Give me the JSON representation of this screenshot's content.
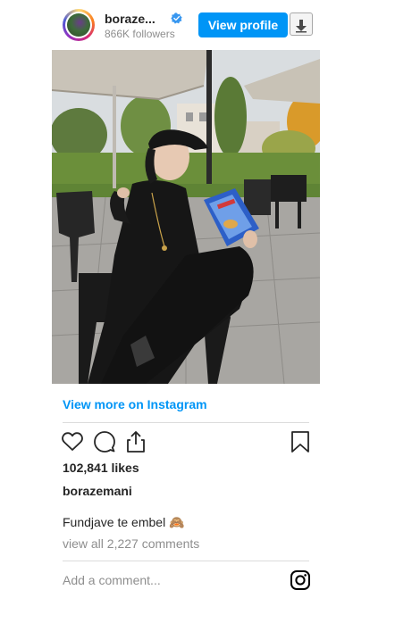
{
  "header": {
    "username": "boraze...",
    "verified_icon": "verified-badge-icon",
    "followers": "866K followers",
    "view_profile_label": "View profile",
    "download_icon": "download-arrow-icon"
  },
  "post": {
    "image_icon": "post-photo",
    "view_more_label": "View more on Instagram",
    "likes": "102,841 likes",
    "owner": "borazemani",
    "caption": "Fundjave te embel 🙈",
    "view_all_comments": "view all 2,227 comments"
  },
  "actions": {
    "like_icon": "heart-icon",
    "comment_icon": "comment-icon",
    "share_icon": "share-icon",
    "save_icon": "bookmark-icon"
  },
  "comment": {
    "placeholder": "Add a comment..."
  },
  "colors": {
    "accent": "#0095f6",
    "text": "#262626",
    "muted": "#8e8e8e",
    "divider": "#dbdbdb"
  }
}
